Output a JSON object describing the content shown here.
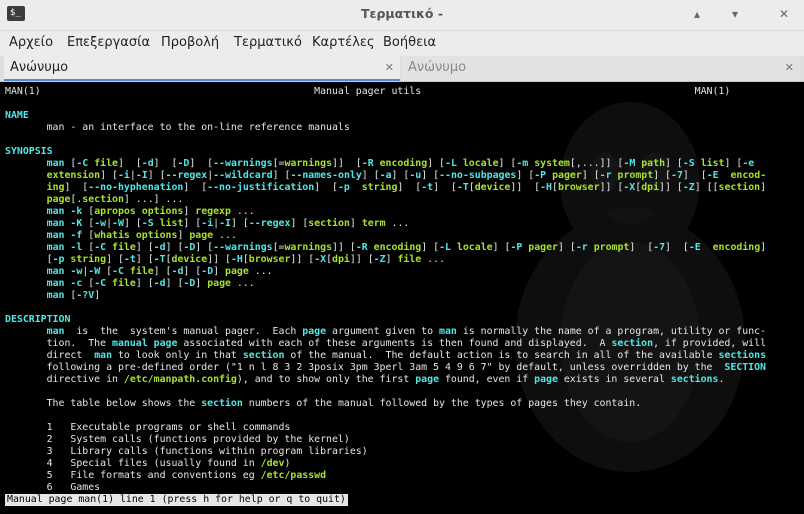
{
  "window": {
    "title": "Τερματικό -",
    "app_icon_label": "$_",
    "buttons": [
      "▴",
      "▾",
      "✕"
    ]
  },
  "menu": [
    "Αρχείο",
    "Επεξεργασία",
    "Προβολή",
    "Τερματικό",
    "Καρτέλες",
    "Βοήθεια"
  ],
  "tabs": [
    {
      "label": "Ανώνυμο",
      "active": true
    },
    {
      "label": "Ανώνυμο",
      "active": false
    }
  ],
  "tab_close": "✕",
  "man": {
    "lines": [
      [
        [
          "MAN(1)                                              Manual pager utils                                              MAN(1)",
          ""
        ]
      ],
      [
        [
          "",
          ""
        ]
      ],
      [
        [
          "NAME",
          "b"
        ]
      ],
      [
        [
          "       man - an interface to the on-line reference manuals",
          ""
        ]
      ],
      [
        [
          "",
          ""
        ]
      ],
      [
        [
          "SYNOPSIS",
          "b"
        ]
      ],
      [
        [
          "       ",
          ""
        ],
        [
          "man",
          "b"
        ],
        [
          " [",
          ""
        ],
        [
          "-C",
          "b"
        ],
        [
          " ",
          ""
        ],
        [
          "file",
          "u"
        ],
        [
          "]  [",
          ""
        ],
        [
          "-d",
          "b"
        ],
        [
          "]  [",
          ""
        ],
        [
          "-D",
          "b"
        ],
        [
          "]  [",
          ""
        ],
        [
          "--warnings",
          "b"
        ],
        [
          "[=",
          ""
        ],
        [
          "warnings",
          "u"
        ],
        [
          "]]  [",
          ""
        ],
        [
          "-R",
          "b"
        ],
        [
          " ",
          ""
        ],
        [
          "encoding",
          "u"
        ],
        [
          "] [",
          ""
        ],
        [
          "-L",
          "b"
        ],
        [
          " ",
          ""
        ],
        [
          "locale",
          "u"
        ],
        [
          "] [",
          ""
        ],
        [
          "-m",
          "b"
        ],
        [
          " ",
          ""
        ],
        [
          "system",
          "u"
        ],
        [
          "[,...]] [",
          ""
        ],
        [
          "-M",
          "b"
        ],
        [
          " ",
          ""
        ],
        [
          "path",
          "u"
        ],
        [
          "] [",
          ""
        ],
        [
          "-S",
          "b"
        ],
        [
          " ",
          ""
        ],
        [
          "list",
          "u"
        ],
        [
          "] [",
          ""
        ],
        [
          "-e",
          "b"
        ]
      ],
      [
        [
          "       ",
          ""
        ],
        [
          "extension",
          "u"
        ],
        [
          "] [",
          ""
        ],
        [
          "-i",
          "b"
        ],
        [
          "|",
          ""
        ],
        [
          "-I",
          "b"
        ],
        [
          "] [",
          ""
        ],
        [
          "--regex",
          "b"
        ],
        [
          "|",
          ""
        ],
        [
          "--wildcard",
          "b"
        ],
        [
          "] [",
          ""
        ],
        [
          "--names-only",
          "b"
        ],
        [
          "] [",
          ""
        ],
        [
          "-a",
          "b"
        ],
        [
          "] [",
          ""
        ],
        [
          "-u",
          "b"
        ],
        [
          "] [",
          ""
        ],
        [
          "--no-subpages",
          "b"
        ],
        [
          "] [",
          ""
        ],
        [
          "-P",
          "b"
        ],
        [
          " ",
          ""
        ],
        [
          "pager",
          "u"
        ],
        [
          "] [",
          ""
        ],
        [
          "-r",
          "b"
        ],
        [
          " ",
          ""
        ],
        [
          "prompt",
          "u"
        ],
        [
          "] [",
          ""
        ],
        [
          "-7",
          "b"
        ],
        [
          "]  [",
          ""
        ],
        [
          "-E",
          "b"
        ],
        [
          "  ",
          ""
        ],
        [
          "encod-",
          "u"
        ]
      ],
      [
        [
          "       ",
          ""
        ],
        [
          "ing",
          "u"
        ],
        [
          "]  [",
          ""
        ],
        [
          "--no-hyphenation",
          "b"
        ],
        [
          "]  [",
          ""
        ],
        [
          "--no-justification",
          "b"
        ],
        [
          "]  [",
          ""
        ],
        [
          "-p",
          "b"
        ],
        [
          "  ",
          ""
        ],
        [
          "string",
          "u"
        ],
        [
          "]  [",
          ""
        ],
        [
          "-t",
          "b"
        ],
        [
          "]  [",
          ""
        ],
        [
          "-T",
          "b"
        ],
        [
          "[",
          ""
        ],
        [
          "device",
          "u"
        ],
        [
          "]]  [",
          ""
        ],
        [
          "-H",
          "b"
        ],
        [
          "[",
          ""
        ],
        [
          "browser",
          "u"
        ],
        [
          "]] [",
          ""
        ],
        [
          "-X",
          "b"
        ],
        [
          "[",
          ""
        ],
        [
          "dpi",
          "u"
        ],
        [
          "]] [",
          ""
        ],
        [
          "-Z",
          "b"
        ],
        [
          "] [[",
          ""
        ],
        [
          "section",
          "u"
        ],
        [
          "]",
          ""
        ]
      ],
      [
        [
          "       ",
          ""
        ],
        [
          "page",
          "u"
        ],
        [
          "[.",
          ""
        ],
        [
          "section",
          "u"
        ],
        [
          "] ...] ...",
          ""
        ]
      ],
      [
        [
          "       ",
          ""
        ],
        [
          "man",
          "b"
        ],
        [
          " ",
          ""
        ],
        [
          "-k",
          "b"
        ],
        [
          " [",
          ""
        ],
        [
          "apropos options",
          "u"
        ],
        [
          "] ",
          ""
        ],
        [
          "regexp",
          "u"
        ],
        [
          " ...",
          ""
        ]
      ],
      [
        [
          "       ",
          ""
        ],
        [
          "man",
          "b"
        ],
        [
          " ",
          ""
        ],
        [
          "-K",
          "b"
        ],
        [
          " [",
          ""
        ],
        [
          "-w",
          "b"
        ],
        [
          "|",
          ""
        ],
        [
          "-W",
          "b"
        ],
        [
          "] [",
          ""
        ],
        [
          "-S",
          "b"
        ],
        [
          " ",
          ""
        ],
        [
          "list",
          "u"
        ],
        [
          "] [",
          ""
        ],
        [
          "-i",
          "b"
        ],
        [
          "|",
          ""
        ],
        [
          "-I",
          "b"
        ],
        [
          "] [",
          ""
        ],
        [
          "--regex",
          "b"
        ],
        [
          "] [",
          ""
        ],
        [
          "section",
          "u"
        ],
        [
          "] ",
          ""
        ],
        [
          "term",
          "u"
        ],
        [
          " ...",
          ""
        ]
      ],
      [
        [
          "       ",
          ""
        ],
        [
          "man",
          "b"
        ],
        [
          " ",
          ""
        ],
        [
          "-f",
          "b"
        ],
        [
          " [",
          ""
        ],
        [
          "whatis options",
          "u"
        ],
        [
          "] ",
          ""
        ],
        [
          "page",
          "u"
        ],
        [
          " ...",
          ""
        ]
      ],
      [
        [
          "       ",
          ""
        ],
        [
          "man",
          "b"
        ],
        [
          " ",
          ""
        ],
        [
          "-l",
          "b"
        ],
        [
          " [",
          ""
        ],
        [
          "-C",
          "b"
        ],
        [
          " ",
          ""
        ],
        [
          "file",
          "u"
        ],
        [
          "] [",
          ""
        ],
        [
          "-d",
          "b"
        ],
        [
          "] [",
          ""
        ],
        [
          "-D",
          "b"
        ],
        [
          "] [",
          ""
        ],
        [
          "--warnings",
          "b"
        ],
        [
          "[=",
          ""
        ],
        [
          "warnings",
          "u"
        ],
        [
          "]] [",
          ""
        ],
        [
          "-R",
          "b"
        ],
        [
          " ",
          ""
        ],
        [
          "encoding",
          "u"
        ],
        [
          "] [",
          ""
        ],
        [
          "-L",
          "b"
        ],
        [
          " ",
          ""
        ],
        [
          "locale",
          "u"
        ],
        [
          "] [",
          ""
        ],
        [
          "-P",
          "b"
        ],
        [
          " ",
          ""
        ],
        [
          "pager",
          "u"
        ],
        [
          "] [",
          ""
        ],
        [
          "-r",
          "b"
        ],
        [
          " ",
          ""
        ],
        [
          "prompt",
          "u"
        ],
        [
          "]  [",
          ""
        ],
        [
          "-7",
          "b"
        ],
        [
          "]  [",
          ""
        ],
        [
          "-E",
          "b"
        ],
        [
          "  ",
          ""
        ],
        [
          "encoding",
          "u"
        ],
        [
          "]",
          ""
        ]
      ],
      [
        [
          "       [",
          ""
        ],
        [
          "-p",
          "b"
        ],
        [
          " ",
          ""
        ],
        [
          "string",
          "u"
        ],
        [
          "] [",
          ""
        ],
        [
          "-t",
          "b"
        ],
        [
          "] [",
          ""
        ],
        [
          "-T",
          "b"
        ],
        [
          "[",
          ""
        ],
        [
          "device",
          "u"
        ],
        [
          "]] [",
          ""
        ],
        [
          "-H",
          "b"
        ],
        [
          "[",
          ""
        ],
        [
          "browser",
          "u"
        ],
        [
          "]] [",
          ""
        ],
        [
          "-X",
          "b"
        ],
        [
          "[",
          ""
        ],
        [
          "dpi",
          "u"
        ],
        [
          "]] [",
          ""
        ],
        [
          "-Z",
          "b"
        ],
        [
          "] ",
          ""
        ],
        [
          "file",
          "u"
        ],
        [
          " ...",
          ""
        ]
      ],
      [
        [
          "       ",
          ""
        ],
        [
          "man",
          "b"
        ],
        [
          " ",
          ""
        ],
        [
          "-w",
          "b"
        ],
        [
          "|",
          ""
        ],
        [
          "-W",
          "b"
        ],
        [
          " [",
          ""
        ],
        [
          "-C",
          "b"
        ],
        [
          " ",
          ""
        ],
        [
          "file",
          "u"
        ],
        [
          "] [",
          ""
        ],
        [
          "-d",
          "b"
        ],
        [
          "] [",
          ""
        ],
        [
          "-D",
          "b"
        ],
        [
          "] ",
          ""
        ],
        [
          "page",
          "u"
        ],
        [
          " ...",
          ""
        ]
      ],
      [
        [
          "       ",
          ""
        ],
        [
          "man",
          "b"
        ],
        [
          " ",
          ""
        ],
        [
          "-c",
          "b"
        ],
        [
          " [",
          ""
        ],
        [
          "-C",
          "b"
        ],
        [
          " ",
          ""
        ],
        [
          "file",
          "u"
        ],
        [
          "] [",
          ""
        ],
        [
          "-d",
          "b"
        ],
        [
          "] [",
          ""
        ],
        [
          "-D",
          "b"
        ],
        [
          "] ",
          ""
        ],
        [
          "page",
          "u"
        ],
        [
          " ...",
          ""
        ]
      ],
      [
        [
          "       ",
          ""
        ],
        [
          "man",
          "b"
        ],
        [
          " [",
          ""
        ],
        [
          "-?V",
          "b"
        ],
        [
          "]",
          ""
        ]
      ],
      [
        [
          "",
          ""
        ]
      ],
      [
        [
          "DESCRIPTION",
          "b"
        ]
      ],
      [
        [
          "       ",
          ""
        ],
        [
          "man",
          "b"
        ],
        [
          "  is  the  system's manual pager.  Each ",
          ""
        ],
        [
          "page",
          "b"
        ],
        [
          " argument given to ",
          ""
        ],
        [
          "man",
          "b"
        ],
        [
          " is normally the name of a program, utility or func-",
          ""
        ]
      ],
      [
        [
          "       tion.  The ",
          ""
        ],
        [
          "manual page",
          "b"
        ],
        [
          " associated with each of these arguments is then found and displayed.  A ",
          ""
        ],
        [
          "section",
          "b"
        ],
        [
          ", if provided, will",
          ""
        ]
      ],
      [
        [
          "       direct  ",
          ""
        ],
        [
          "man",
          "b"
        ],
        [
          " to look only in that ",
          ""
        ],
        [
          "section",
          "b"
        ],
        [
          " of the manual.  The default action is to search in all of the available ",
          ""
        ],
        [
          "sections",
          "b"
        ]
      ],
      [
        [
          "       following a pre-defined order (\"1 n l 8 3 2 3posix 3pm 3perl 3am 5 4 9 6 7\" by default, unless overridden by the  ",
          ""
        ],
        [
          "SECTION",
          "b"
        ]
      ],
      [
        [
          "       directive in ",
          ""
        ],
        [
          "/etc/manpath.config",
          "u"
        ],
        [
          "), and to show only the first ",
          ""
        ],
        [
          "page",
          "b"
        ],
        [
          " found, even if ",
          ""
        ],
        [
          "page",
          "b"
        ],
        [
          " exists in several ",
          ""
        ],
        [
          "sections",
          "b"
        ],
        [
          ".",
          ""
        ]
      ],
      [
        [
          "",
          ""
        ]
      ],
      [
        [
          "       The table below shows the ",
          ""
        ],
        [
          "section",
          "b"
        ],
        [
          " numbers of the manual followed by the types of pages they contain.",
          ""
        ]
      ],
      [
        [
          "",
          ""
        ]
      ],
      [
        [
          "       1   Executable programs or shell commands",
          ""
        ]
      ],
      [
        [
          "       2   System calls (functions provided by the kernel)",
          ""
        ]
      ],
      [
        [
          "       3   Library calls (functions within program libraries)",
          ""
        ]
      ],
      [
        [
          "       4   Special files (usually found in ",
          ""
        ],
        [
          "/dev",
          "u"
        ],
        [
          ")",
          ""
        ]
      ],
      [
        [
          "       5   File formats and conventions eg ",
          ""
        ],
        [
          "/etc/passwd",
          "u"
        ]
      ],
      [
        [
          "       6   Games",
          ""
        ]
      ]
    ],
    "status": "Manual page man(1) line 1 (press h for help or q to quit)"
  }
}
